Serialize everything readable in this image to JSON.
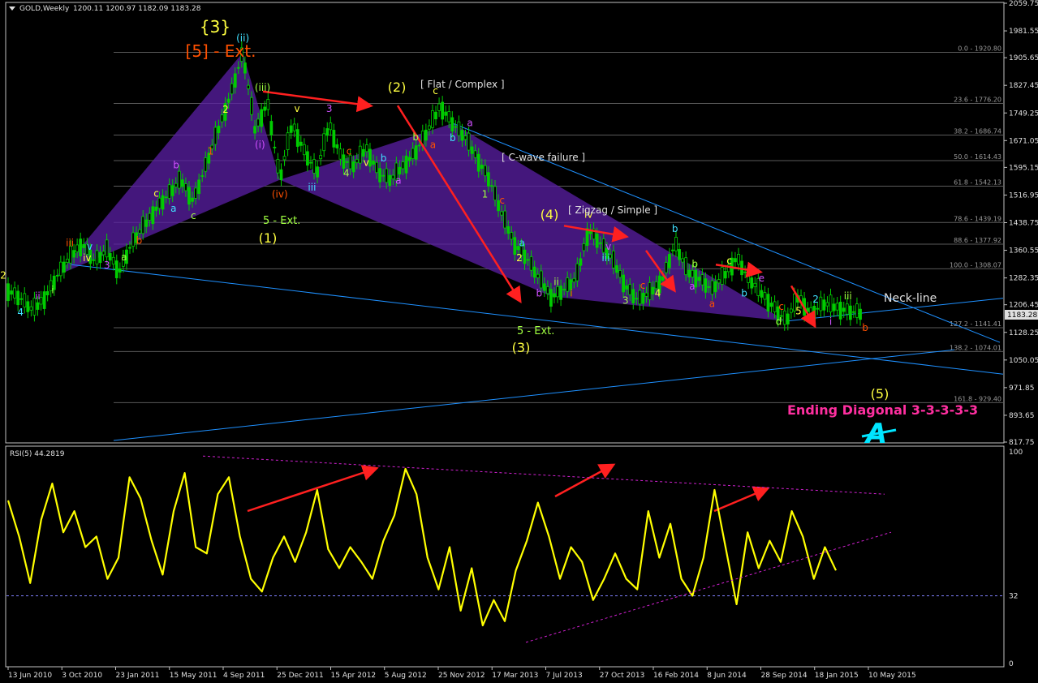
{
  "window": {
    "symbol_label": "GOLD,Weekly",
    "ohlc": "1200.11 1200.97 1182.09 1183.28",
    "menu_icon": "triangle-down-icon"
  },
  "colors": {
    "background": "#000000",
    "frame": "#c0c0c0",
    "grid": "#5a5a5a",
    "candle": "#00cc00",
    "fib_line": "#5a5a5a",
    "trend_line": "#1e90ff",
    "wedge_fill": "#5b1fa6",
    "arrow": "#ff2020",
    "rsi_line": "#ffff00",
    "rsi_level": "#8080ff",
    "rsi_trend": "#d020d0",
    "label_yellow": "#ffff40",
    "label_cyan": "#40e0ff",
    "label_magenta": "#d050ff",
    "label_orange": "#ff5000",
    "label_pink": "#ff2fa0",
    "label_green": "#a0ff40",
    "label_white": "#e0e0e0"
  },
  "chart_data": {
    "type": "line",
    "title": "GOLD,Weekly",
    "price_axis": {
      "ylim": [
        817.75,
        2059.75
      ],
      "ticks": [
        "2059.75",
        "1981.55",
        "1905.65",
        "1827.45",
        "1749.25",
        "1671.05",
        "1595.15",
        "1516.95",
        "1438.75",
        "1360.55",
        "1282.35",
        "1206.45",
        "1128.25",
        "1050.05",
        "971.85",
        "893.65",
        "817.75"
      ],
      "current_price_label": "1183.28"
    },
    "x_axis": {
      "tick_labels": [
        "13 Jun 2010",
        "3 Oct 2010",
        "23 Jan 2011",
        "15 May 2011",
        "4 Sep 2011",
        "25 Dec 2011",
        "15 Apr 2012",
        "5 Aug 2012",
        "25 Nov 2012",
        "17 Mar 2013",
        "7 Jul 2013",
        "27 Oct 2013",
        "16 Feb 2014",
        "8 Jun 2014",
        "28 Sep 2014",
        "18 Jan 2015",
        "10 May 2015"
      ]
    },
    "series": [
      {
        "values": [
          1248,
          1226,
          1190,
          1228,
          1290,
          1340,
          1380,
          1330,
          1360,
          1300,
          1380,
          1430,
          1480,
          1520,
          1560,
          1500,
          1600,
          1700,
          1800,
          1920,
          1700,
          1780,
          1560,
          1720,
          1640,
          1580,
          1720,
          1620,
          1600,
          1650,
          1580,
          1560,
          1600,
          1640,
          1700,
          1770,
          1720,
          1680,
          1620,
          1560,
          1460,
          1380,
          1340,
          1280,
          1230,
          1250,
          1280,
          1420,
          1380,
          1330,
          1260,
          1220,
          1240,
          1280,
          1380,
          1300,
          1280,
          1250,
          1290,
          1340,
          1280,
          1240,
          1200,
          1160,
          1230,
          1180,
          1210,
          1200,
          1190,
          1183
        ]
      }
    ],
    "fibonacci_levels": [
      {
        "label": "0.0 - 1920.80",
        "value": 1920.8
      },
      {
        "label": "23.6 - 1776.20",
        "value": 1776.2
      },
      {
        "label": "38.2 - 1686.74",
        "value": 1686.74
      },
      {
        "label": "50.0 - 1614.43",
        "value": 1614.43
      },
      {
        "label": "61.8 - 1542.13",
        "value": 1542.13
      },
      {
        "label": "78.6 - 1439.19",
        "value": 1439.19
      },
      {
        "label": "88.6 - 1377.92",
        "value": 1377.92
      },
      {
        "label": "100.0 - 1308.07",
        "value": 1308.07
      },
      {
        "label": "127.2 - 1141.41",
        "value": 1141.41
      },
      {
        "label": "138.2 - 1074.01",
        "value": 1074.01
      },
      {
        "label": "161.8 - 929.40",
        "value": 929.4
      }
    ],
    "annotations": {
      "big": [
        "{3}",
        "[5] - Ext.",
        "(2)",
        "(1)",
        "(3)",
        "(4)",
        "(5)"
      ],
      "notes": [
        "[ Flat / Complex ]",
        "[ C-wave failure ]",
        "[ Zigzag / Simple ]",
        "Neck-line",
        "Ending Diagonal 3-3-3-3-3",
        "5 - Ext.",
        "5 - Ext."
      ],
      "wave_labels": [
        "2",
        "4",
        "ii",
        "i",
        "iii",
        "iv",
        "v",
        "3",
        "a",
        "b",
        "c",
        "a",
        "b",
        "c",
        "1",
        "2",
        "(ii)",
        "(i)",
        "(iii)",
        "(iv)",
        "v",
        "iii",
        "3",
        "4",
        "c",
        "v",
        "b",
        "a",
        "b",
        "a",
        "c",
        "b",
        "a",
        "1",
        "c",
        "2",
        "a",
        "b",
        "ii",
        "i",
        "iv",
        "iii",
        "v",
        "3",
        "c",
        "4",
        "b",
        "a",
        "b",
        "a",
        "c",
        "b",
        "e",
        "d",
        "c",
        "5",
        "2",
        "i",
        "iii",
        "b"
      ]
    },
    "rsi": {
      "label": "RSI(5) 44.2819",
      "ylim": [
        0,
        100
      ],
      "ticks": [
        "100",
        "32",
        "0"
      ],
      "levels": [
        32
      ],
      "values": [
        77,
        60,
        38,
        68,
        85,
        62,
        72,
        55,
        60,
        40,
        50,
        88,
        78,
        58,
        42,
        72,
        90,
        55,
        52,
        80,
        88,
        60,
        40,
        34,
        50,
        60,
        48,
        62,
        82,
        54,
        45,
        55,
        48,
        40,
        58,
        70,
        92,
        80,
        50,
        35,
        55,
        25,
        45,
        18,
        30,
        20,
        44,
        58,
        76,
        60,
        40,
        55,
        48,
        30,
        40,
        52,
        40,
        35,
        72,
        50,
        66,
        40,
        32,
        50,
        82,
        55,
        28,
        62,
        45,
        58,
        48,
        72,
        60,
        40,
        55,
        44
      ]
    }
  }
}
